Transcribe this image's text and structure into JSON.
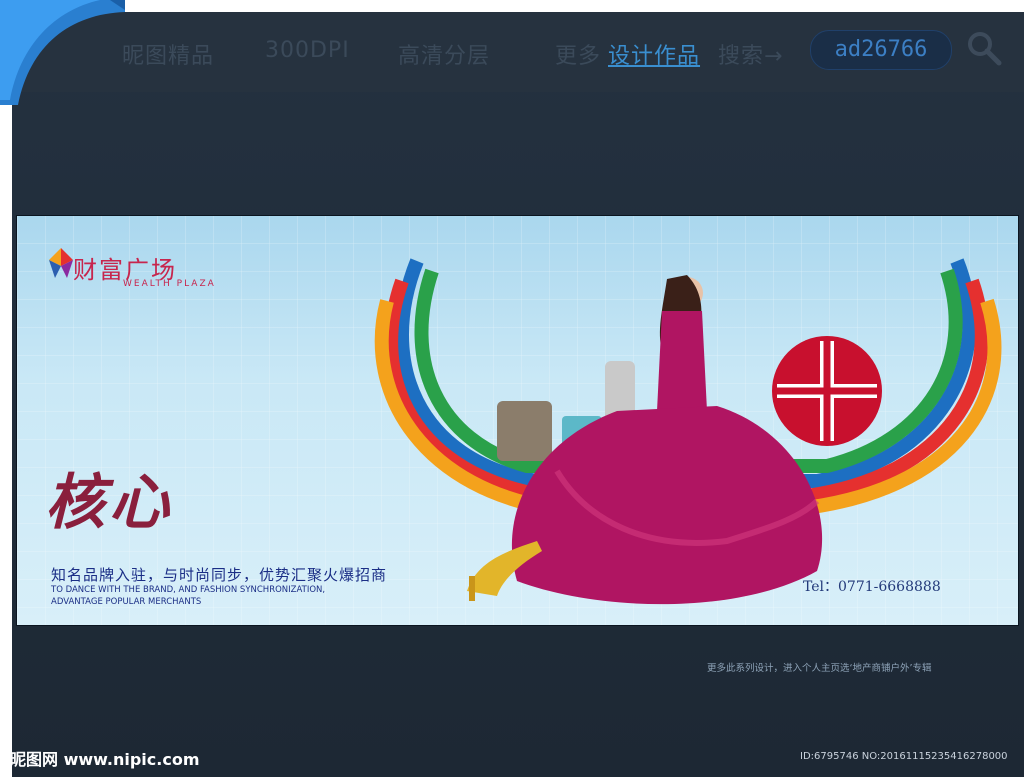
{
  "header": {
    "nav_items": [
      "昵图精品",
      "300DPI",
      "高清分层",
      "更多"
    ],
    "link_label": "设计作品",
    "search_suffix": "搜索→",
    "search_value": "ad26766"
  },
  "banner": {
    "logo_cn": "财富广场",
    "logo_en": "WEALTH PLAZA",
    "headline": "核心",
    "tagline_cn": "知名品牌入驻，与时尚同步，优势汇聚火爆招商",
    "tagline_en_1": "TO DANCE WITH THE BRAND, AND FASHION SYNCHRONIZATION,",
    "tagline_en_2": "ADVANTAGE POPULAR MERCHANTS",
    "tel": "Tel：0771-6668888"
  },
  "footer": {
    "series_note": "更多此系列设计，进入个人主页选‘地产商铺户外’专辑",
    "watermark": "昵图网 www.nipic.com",
    "id_line": "ID:6795746 NO:20161115235416278000"
  },
  "colors": {
    "frame": "#1f2b38",
    "accent_blue": "#3a8fd0",
    "brand_red": "#c7254d",
    "dress": "#b01562"
  }
}
